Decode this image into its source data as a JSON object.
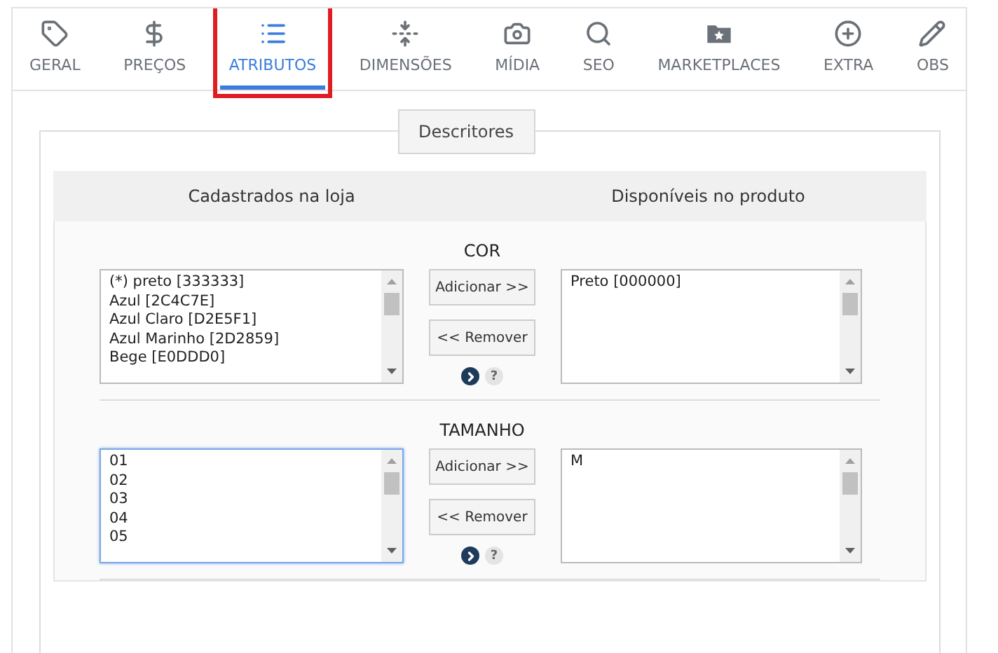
{
  "tabs": [
    {
      "label": "GERAL",
      "selected": false,
      "highlighted": false
    },
    {
      "label": "PREÇOS",
      "selected": false,
      "highlighted": false
    },
    {
      "label": "ATRIBUTOS",
      "selected": true,
      "highlighted": true
    },
    {
      "label": "DIMENSÕES",
      "selected": false,
      "highlighted": false
    },
    {
      "label": "MÍDIA",
      "selected": false,
      "highlighted": false
    },
    {
      "label": "SEO",
      "selected": false,
      "highlighted": false
    },
    {
      "label": "MARKETPLACES",
      "selected": false,
      "highlighted": false
    },
    {
      "label": "EXTRA",
      "selected": false,
      "highlighted": false
    },
    {
      "label": "OBS",
      "selected": false,
      "highlighted": false
    }
  ],
  "descriptors": {
    "legend": "Descritores",
    "columns": [
      "Cadastrados na loja",
      "Disponíveis no produto"
    ],
    "attributes": [
      {
        "name": "COR",
        "store_options": [
          "(*) preto [333333]",
          "Azul [2C4C7E]",
          "Azul Claro [D2E5F1]",
          "Azul Marinho [2D2859]",
          "Bege [E0DDD0]"
        ],
        "store_focused": false,
        "product_options": [
          "Preto [000000]"
        ],
        "add_button": "Adicionar >>",
        "remove_button": "<< Remover",
        "help": "?"
      },
      {
        "name": "TAMANHO",
        "store_options": [
          "01",
          "02",
          "03",
          "04",
          "05"
        ],
        "store_focused": true,
        "product_options": [
          "M"
        ],
        "add_button": "Adicionar >>",
        "remove_button": "<< Remover",
        "help": "?"
      }
    ]
  }
}
